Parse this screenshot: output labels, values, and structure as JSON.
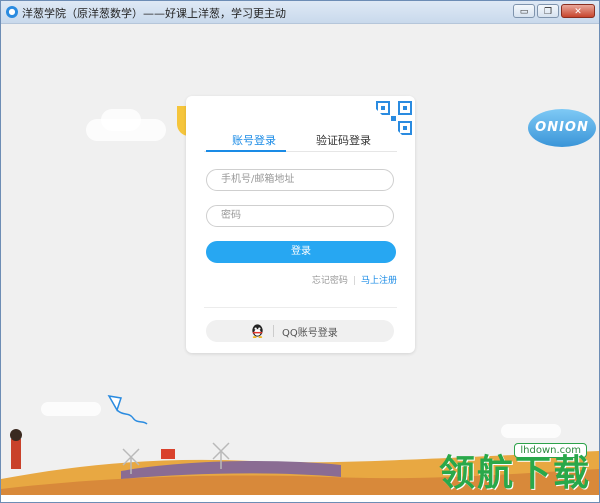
{
  "window": {
    "title": "洋葱学院（原洋葱数学）——好课上洋葱，学习更主动",
    "controls": {
      "minimize": "▭",
      "restore": "❐",
      "close": "✕"
    }
  },
  "login": {
    "tabs": [
      {
        "label": "账号登录",
        "active": true
      },
      {
        "label": "验证码登录",
        "active": false
      }
    ],
    "account_placeholder": "手机号/邮箱地址",
    "password_placeholder": "密码",
    "login_button": "登录",
    "forgot_password": "忘记密码",
    "separator": "|",
    "register": "马上注册",
    "qq_login": "QQ账号登录"
  },
  "background": {
    "blimp_text": "ONION"
  },
  "watermark": {
    "text": "领航下载",
    "url": "lhdown.com"
  },
  "colors": {
    "accent": "#1a8be6",
    "button": "#27a7f2",
    "watermark": "#29a84a"
  }
}
